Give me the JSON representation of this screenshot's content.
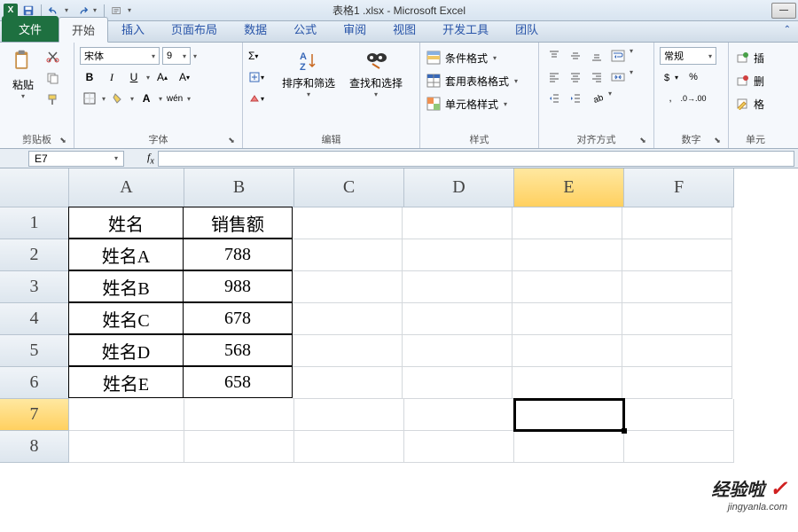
{
  "title": "表格1 .xlsx - Microsoft Excel",
  "tabs": {
    "file": "文件",
    "home": "开始",
    "insert": "插入",
    "pagelayout": "页面布局",
    "data": "数据",
    "formulas": "公式",
    "review": "审阅",
    "view": "视图",
    "developer": "开发工具",
    "team": "团队"
  },
  "ribbon": {
    "clipboard": {
      "paste": "粘贴",
      "label": "剪贴板"
    },
    "font": {
      "name": "宋体",
      "size": "9",
      "label": "字体"
    },
    "editing": {
      "sortfilter": "排序和筛选",
      "findselect": "查找和选择",
      "label": "编辑"
    },
    "styles": {
      "conditional": "条件格式",
      "formatastable": "套用表格格式",
      "cellstyles": "单元格样式",
      "label": "样式"
    },
    "alignment": {
      "label": "对齐方式"
    },
    "number": {
      "format": "常规",
      "label": "数字"
    },
    "cells": {
      "insert": "插",
      "delete": "删",
      "format": "格",
      "label": "单元"
    }
  },
  "namebox": "E7",
  "columns": [
    "A",
    "B",
    "C",
    "D",
    "E",
    "F"
  ],
  "rows": [
    "1",
    "2",
    "3",
    "4",
    "5",
    "6",
    "7",
    "8"
  ],
  "activeCol": "E",
  "activeRow": "7",
  "chart_data": {
    "type": "table",
    "title": "",
    "headers": [
      "姓名",
      "销售额"
    ],
    "rows": [
      [
        "姓名A",
        788
      ],
      [
        "姓名B",
        988
      ],
      [
        "姓名C",
        678
      ],
      [
        "姓名D",
        568
      ],
      [
        "姓名E",
        658
      ]
    ]
  },
  "watermark": {
    "line1": "经验啦",
    "line2": "jingyanla.com"
  }
}
